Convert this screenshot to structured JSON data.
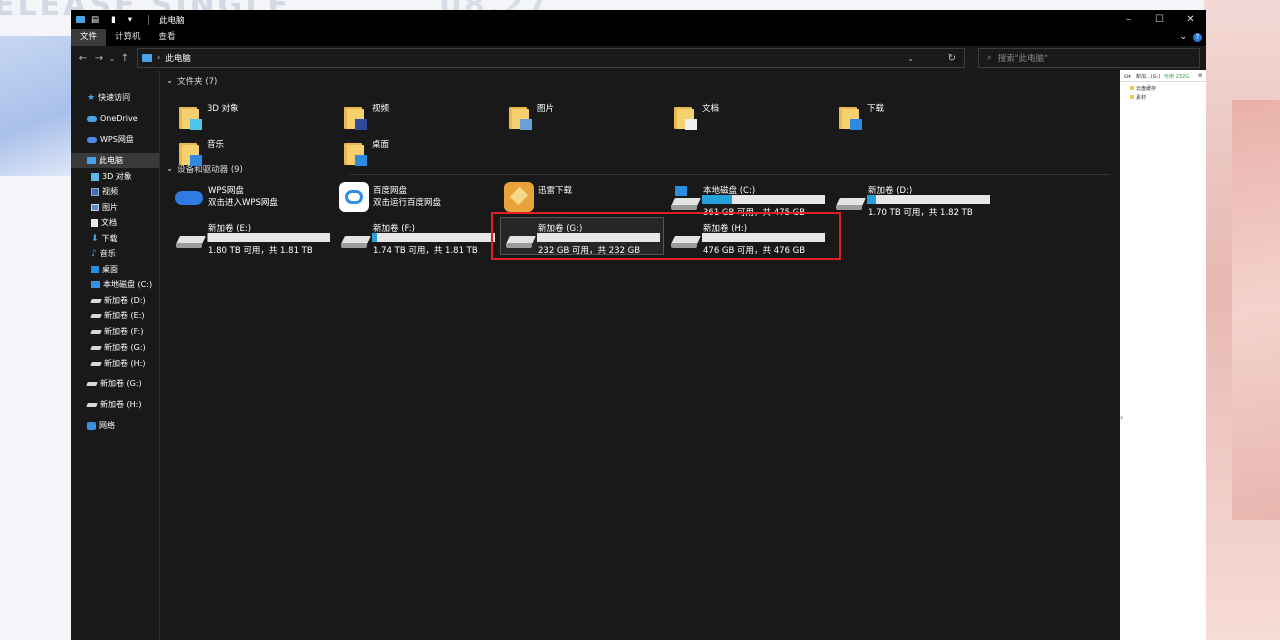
{
  "background": {
    "text_left": "ELEASE SINGLE",
    "text_right": "08.27"
  },
  "window": {
    "title": "此电脑",
    "controls": {
      "minimize": "–",
      "maximize": "☐",
      "close": "✕"
    }
  },
  "ribbon": {
    "tabs": [
      "文件",
      "计算机",
      "查看"
    ],
    "active_tab": "文件",
    "help": "?",
    "expand": "⌄"
  },
  "address": {
    "path": "此电脑",
    "search_placeholder": "搜索\"此电脑\""
  },
  "sidebar": {
    "items": [
      {
        "label": "快速访问",
        "icon": "star-icon"
      },
      {
        "label": "OneDrive",
        "icon": "cloud-icon"
      },
      {
        "label": "WPS网盘",
        "icon": "wps-cloud-icon"
      },
      {
        "label": "此电脑",
        "icon": "pc-icon",
        "selected": true
      },
      {
        "label": "3D 对象",
        "icon": "cube-icon"
      },
      {
        "label": "视频",
        "icon": "video-icon"
      },
      {
        "label": "图片",
        "icon": "picture-icon"
      },
      {
        "label": "文档",
        "icon": "document-icon"
      },
      {
        "label": "下载",
        "icon": "download-icon"
      },
      {
        "label": "音乐",
        "icon": "music-icon"
      },
      {
        "label": "桌面",
        "icon": "desktop-icon"
      },
      {
        "label": "本地磁盘 (C:)",
        "icon": "windows-drive-icon"
      },
      {
        "label": "新加卷 (D:)",
        "icon": "drive-icon"
      },
      {
        "label": "新加卷 (E:)",
        "icon": "drive-icon"
      },
      {
        "label": "新加卷 (F:)",
        "icon": "drive-icon"
      },
      {
        "label": "新加卷 (G:)",
        "icon": "drive-icon"
      },
      {
        "label": "新加卷 (H:)",
        "icon": "drive-icon"
      },
      {
        "label": "新加卷 (G:)",
        "icon": "drive-icon"
      },
      {
        "label": "新加卷 (H:)",
        "icon": "drive-icon"
      },
      {
        "label": "网络",
        "icon": "network-icon"
      }
    ]
  },
  "folders": {
    "header": "文件夹 (7)",
    "items": [
      {
        "label": "3D 对象",
        "icon": "folder-3d-icon"
      },
      {
        "label": "视频",
        "icon": "folder-video-icon"
      },
      {
        "label": "图片",
        "icon": "folder-picture-icon"
      },
      {
        "label": "文档",
        "icon": "folder-document-icon"
      },
      {
        "label": "下载",
        "icon": "folder-download-icon"
      },
      {
        "label": "音乐",
        "icon": "folder-music-icon"
      },
      {
        "label": "桌面",
        "icon": "folder-desktop-icon"
      }
    ]
  },
  "devices": {
    "header": "设备和驱动器 (9)",
    "apps": [
      {
        "name": "WPS网盘",
        "sub": "双击进入WPS网盘",
        "icon": "wps-cloud-icon",
        "color": "#2f7be6"
      },
      {
        "name": "百度网盘",
        "sub": "双击运行百度网盘",
        "icon": "baidu-netdisk-icon",
        "color": "#2f8ee6"
      },
      {
        "name": "迅雷下载",
        "sub": "",
        "icon": "xunlei-icon",
        "color": "#e8a43a"
      }
    ],
    "drives": [
      {
        "name": "本地磁盘 (C:)",
        "info": "361 GB 可用，共 475 GB",
        "used_fraction": 0.24,
        "system": true
      },
      {
        "name": "新加卷 (D:)",
        "info": "1.70 TB 可用，共 1.82 TB",
        "used_fraction": 0.07
      },
      {
        "name": "新加卷 (E:)",
        "info": "1.80 TB 可用，共 1.81 TB",
        "used_fraction": 0.01
      },
      {
        "name": "新加卷 (F:)",
        "info": "1.74 TB 可用，共 1.81 TB",
        "used_fraction": 0.04
      },
      {
        "name": "新加卷 (G:)",
        "info": "232 GB 可用，共 232 GB",
        "used_fraction": 0.0,
        "selected": true
      },
      {
        "name": "新加卷 (H:)",
        "info": "476 GB 可用，共 476 GB",
        "used_fraction": 0.0
      }
    ]
  },
  "preview": {
    "drive": "新加...(G:)",
    "free": "可用 232G",
    "items": [
      "云盘缓存",
      "素材"
    ]
  },
  "colors": {
    "accent": "#26a0da",
    "highlight": "#e02020",
    "window_bg": "#191919"
  }
}
